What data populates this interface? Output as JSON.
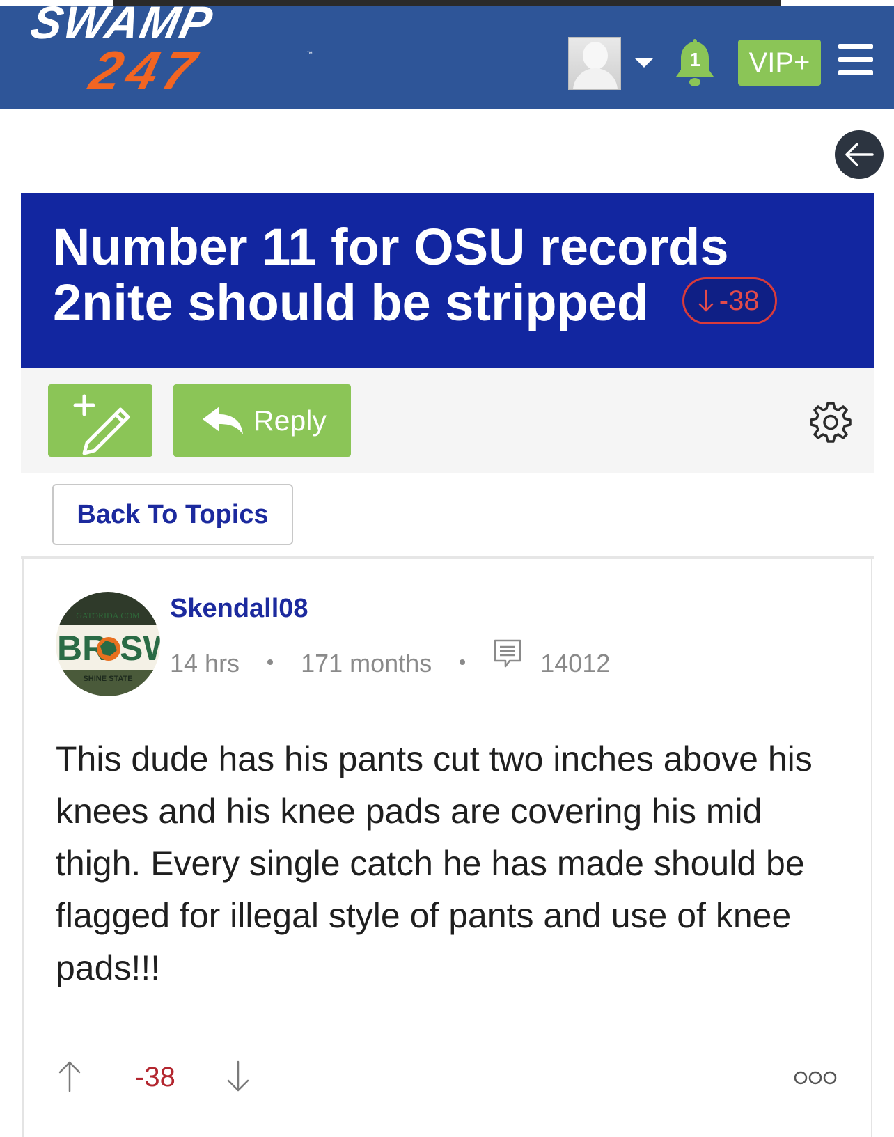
{
  "header": {
    "logo_top": "SWAMP",
    "logo_bottom": "247",
    "logo_tm": "™",
    "notification_count": "1",
    "vip_label": "VIP+",
    "brand_color": "#2e5598",
    "accent_green": "#8bc557",
    "icons": [
      "avatar",
      "dropdown-caret-icon",
      "bell-icon",
      "hamburger-menu-icon"
    ]
  },
  "nav": {
    "back_icon": "arrow-left-icon"
  },
  "topic": {
    "title": "Number 11 for OSU records 2nite should be stripped",
    "score": "-38",
    "score_icon": "arrow-down-icon",
    "banner_color": "#1226a0"
  },
  "actions": {
    "new_topic_icon": "new-post-pencil-icon",
    "reply_label": "Reply",
    "reply_icon": "reply-arrow-icon",
    "settings_icon": "gear-icon",
    "back_to_topics_label": "Back To Topics"
  },
  "post": {
    "username": "Skendall08",
    "time_ago": "14 hrs",
    "member_for": "171 months",
    "post_count": "14012",
    "post_count_icon": "message-icon",
    "avatar_text_top": "GATORIDA.COM",
    "avatar_text_mid_left": "BR",
    "avatar_text_mid_right": "SWA",
    "avatar_text_bottom": "SHINE STATE",
    "body": "This dude has his pants cut two inches above his knees and his knee pads are covering his mid thigh. Every single catch he has made should be flagged for illegal style of pants and use of knee pads!!!",
    "score": "-38",
    "score_color": "#b3262f",
    "vote_up_icon": "arrow-up-icon",
    "vote_down_icon": "arrow-down-icon",
    "more_icon": "more-options-icon"
  }
}
